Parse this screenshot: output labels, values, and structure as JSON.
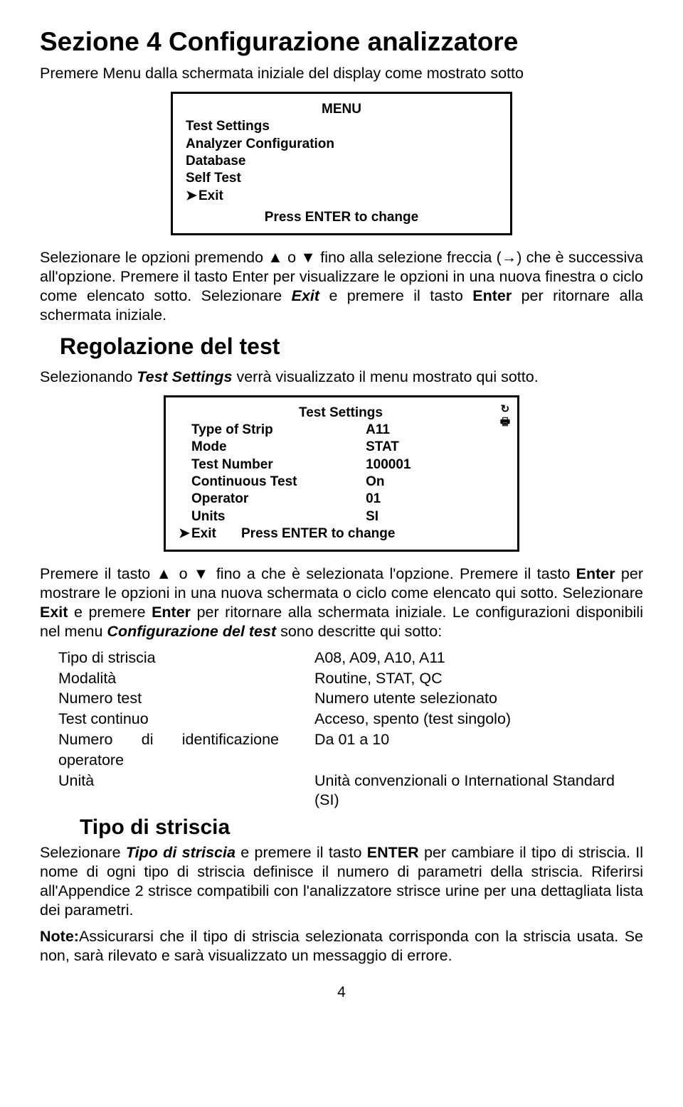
{
  "section_title": "Sezione 4   Configurazione analizzatore",
  "intro": "Premere Menu dalla schermata iniziale del display come mostrato sotto",
  "lcd1": {
    "title": "MENU",
    "items": [
      "Test Settings",
      "Analyzer Configuration",
      "Database",
      "Self Test"
    ],
    "exit": "Exit",
    "footer": "Press ENTER to change"
  },
  "para1_a": "Selezionare le opzioni premendo ▲ o ▼ fino alla selezione freccia (→) che è successiva all'opzione. Premere il tasto Enter per visualizzare le opzioni in una nuova finestra o ciclo come elencato sotto. Selezionare ",
  "para1_exit": "Exit",
  "para1_b": " e premere il tasto ",
  "para1_enter": "Enter",
  "para1_c": " per ritornare alla schermata iniziale.",
  "h2": "Regolazione del test",
  "para2_a": "Selezionando ",
  "para2_b": "Test Settings",
  "para2_c": " verrà visualizzato il menu mostrato qui sotto.",
  "lcd2": {
    "title": "Test Settings",
    "rows": [
      {
        "k": "Type of Strip",
        "v": "A11"
      },
      {
        "k": "Mode",
        "v": "STAT"
      },
      {
        "k": "Test Number",
        "v": "100001"
      },
      {
        "k": "Continuous Test",
        "v": "On"
      },
      {
        "k": "Operator",
        "v": "01"
      },
      {
        "k": "Units",
        "v": "SI"
      }
    ],
    "exit": "Exit",
    "footer_after": "Press ENTER to change",
    "icon_top": "↻",
    "icon_bot": "🖶"
  },
  "para3_a": "Premere il tasto ▲ o ▼ fino a che è selezionata l'opzione. Premere il tasto ",
  "para3_enter": "Enter",
  "para3_b": " per mostrare le opzioni in una nuova schermata o ciclo come elencato qui sotto. Selezionare ",
  "para3_exit": "Exit",
  "para3_c": " e premere ",
  "para3_enter2": "Enter",
  "para3_d": " per ritornare alla schermata iniziale. Le configurazioni disponibili nel menu ",
  "para3_conf": "Configurazione del test",
  "para3_e": " sono descritte qui sotto:",
  "cfg": [
    {
      "k": "Tipo di striscia",
      "v": "A08, A09, A10, A11"
    },
    {
      "k": "Modalità",
      "v": "Routine, STAT, QC"
    },
    {
      "k": "Numero test",
      "v": "Numero utente selezionato"
    },
    {
      "k": "Test continuo",
      "v": "Acceso, spento (test singolo)"
    }
  ],
  "cfg_op_k1": "Numero",
  "cfg_op_k2": "di",
  "cfg_op_k3": "identificazione",
  "cfg_op_k_line2": "operatore",
  "cfg_op_v": "Da 01 a 10",
  "cfg_unita_k": "Unità",
  "cfg_unita_v": "Unità convenzionali o International Standard (SI)",
  "h3": "Tipo di striscia",
  "para4_a": "Selezionare ",
  "para4_b": "Tipo di striscia",
  "para4_c": " e premere il tasto ",
  "para4_enter": "ENTER",
  "para4_d": " per cambiare il tipo di striscia. Il nome di ogni tipo di striscia definisce il numero di parametri della striscia. Riferirsi all'Appendice 2 strisce compatibili con l'analizzatore strisce urine per una dettagliata lista dei parametri.",
  "para5_label": "Note:",
  "para5": "Assicurarsi che il tipo di striscia selezionata corrisponda con la striscia usata. Se non, sarà rilevato e sarà visualizzato un messaggio di errore.",
  "page_number": "4"
}
